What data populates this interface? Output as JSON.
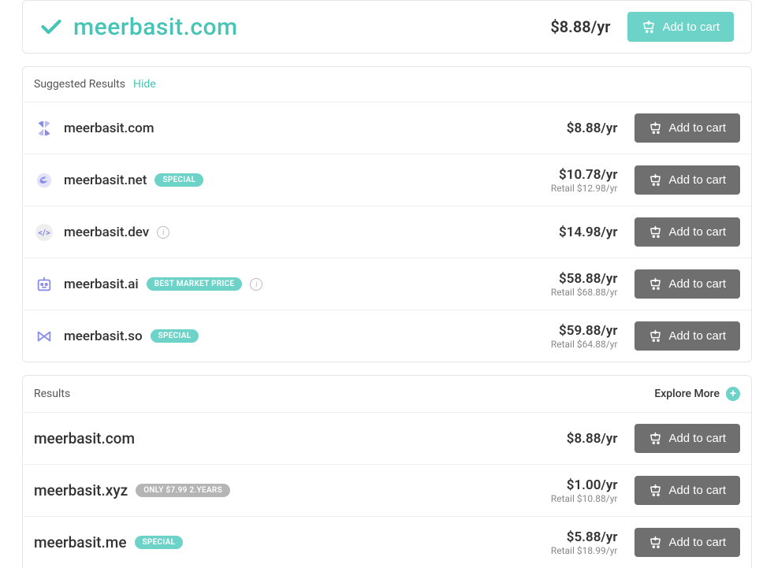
{
  "hero": {
    "domain": "meerbasit.com",
    "price": "$8.88/yr",
    "cta": "Add to cart"
  },
  "suggested": {
    "title": "Suggested Results",
    "hide_label": "Hide",
    "cta": "Add to cart",
    "items": [
      {
        "domain": "meerbasit.com",
        "price": "$8.88/yr",
        "retail": "",
        "badge": "",
        "badge_style": "",
        "info": false,
        "icon": "globe"
      },
      {
        "domain": "meerbasit.net",
        "price": "$10.78/yr",
        "retail": "Retail $12.98/yr",
        "badge": "SPECIAL",
        "badge_style": "teal",
        "info": false,
        "icon": "swirl"
      },
      {
        "domain": "meerbasit.dev",
        "price": "$14.98/yr",
        "retail": "",
        "badge": "",
        "badge_style": "",
        "info": true,
        "icon": "code"
      },
      {
        "domain": "meerbasit.ai",
        "price": "$58.88/yr",
        "retail": "Retail $68.88/yr",
        "badge": "BEST MARKET PRICE",
        "badge_style": "teal",
        "info": true,
        "icon": "robot"
      },
      {
        "domain": "meerbasit.so",
        "price": "$59.88/yr",
        "retail": "Retail $64.88/yr",
        "badge": "SPECIAL",
        "badge_style": "teal",
        "info": false,
        "icon": "bowtie"
      }
    ]
  },
  "results": {
    "title": "Results",
    "explore_label": "Explore More",
    "cta": "Add to cart",
    "items": [
      {
        "domain": "meerbasit.com",
        "price": "$8.88/yr",
        "retail": "",
        "badge": "",
        "badge_style": ""
      },
      {
        "domain": "meerbasit.xyz",
        "price": "$1.00/yr",
        "retail": "Retail $10.88/yr",
        "badge": "ONLY $7.99 2.YEARS",
        "badge_style": "gray"
      },
      {
        "domain": "meerbasit.me",
        "price": "$5.88/yr",
        "retail": "Retail $18.99/yr",
        "badge": "SPECIAL",
        "badge_style": "teal"
      }
    ]
  }
}
